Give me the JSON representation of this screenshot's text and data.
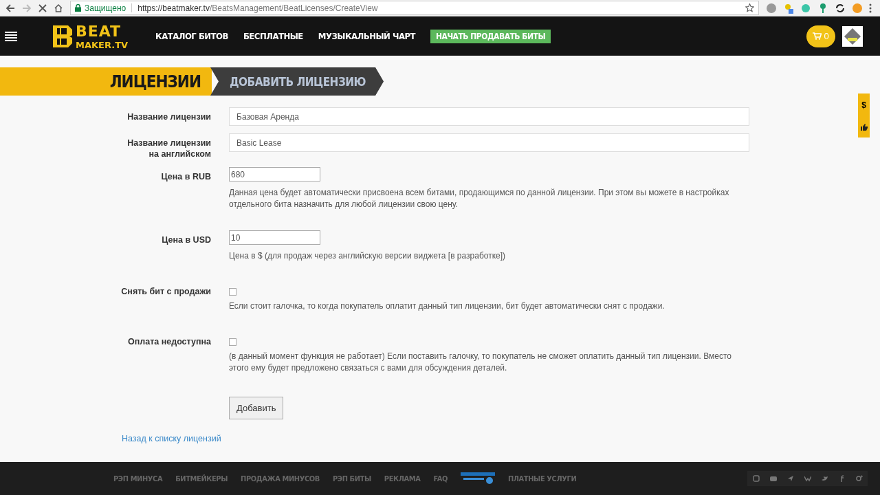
{
  "browser": {
    "security": "Защищено",
    "url_host": "https://beatmaker.tv",
    "url_path": "/BeatsManagement/BeatLicenses/CreateView"
  },
  "header": {
    "logo_top": "BEAT",
    "logo_bottom": "MAKER.TV",
    "nav": [
      {
        "label": "КАТАЛОГ БИТОВ",
        "kind": "link"
      },
      {
        "label": "БЕСПЛАТНЫЕ",
        "kind": "link"
      },
      {
        "label": "МУЗЫКАЛЬНЫЙ ЧАРТ",
        "kind": "link"
      },
      {
        "label": "НАЧАТЬ ПРОДАВАТЬ БИТЫ",
        "kind": "cta"
      }
    ],
    "cart_count": "0"
  },
  "breadcrumb": [
    "ЛИЦЕНЗИИ",
    "ДОБАВИТЬ ЛИЦЕНЗИЮ"
  ],
  "side_tab": {
    "symbol": "$"
  },
  "form": {
    "fields": [
      {
        "kind": "text",
        "label": "Название лицензии",
        "value": "Базовая Аренда"
      },
      {
        "kind": "text",
        "label": "Название лицензии на английском",
        "value": "Basic Lease"
      },
      {
        "kind": "short",
        "label": "Цена в RUB",
        "value": "680",
        "help": "Данная цена будет автоматически присвоена всем битами, продающимся по данной лицензии. При этом вы можете в настройках отдельного бита назначить для любой лицензии свою цену."
      },
      {
        "kind": "short",
        "label": "Цена в USD",
        "value": "10",
        "help": "Цена в $ (для продаж через английскую версии виджета [в разработке])"
      },
      {
        "kind": "checkbox",
        "label": "Снять бит с продажи",
        "checked": false,
        "help": "Если стоит галочка, то когда покупатель оплатит данный тип лицензии, бит будет автоматически снят с продажи."
      },
      {
        "kind": "checkbox",
        "label": "Оплата недоступна",
        "checked": false,
        "help": "(в данный момент функция не работает) Если поставить галочку, то покупатель не сможет оплатить данный тип лицензии. Вместо этого ему будет предложено связаться с вами для обсуждения деталей."
      }
    ],
    "submit": "Добавить",
    "back_link": "Назад к списку лицензий"
  },
  "footer": {
    "links": [
      "РЭП МИНУСА",
      "БИТМЕЙКЕРЫ",
      "ПРОДАЖА МИНУСОВ",
      "РЭП БИТЫ",
      "РЕКЛАМА",
      "FAQ",
      "ПЛАТНЫЕ УСЛУГИ"
    ]
  }
}
